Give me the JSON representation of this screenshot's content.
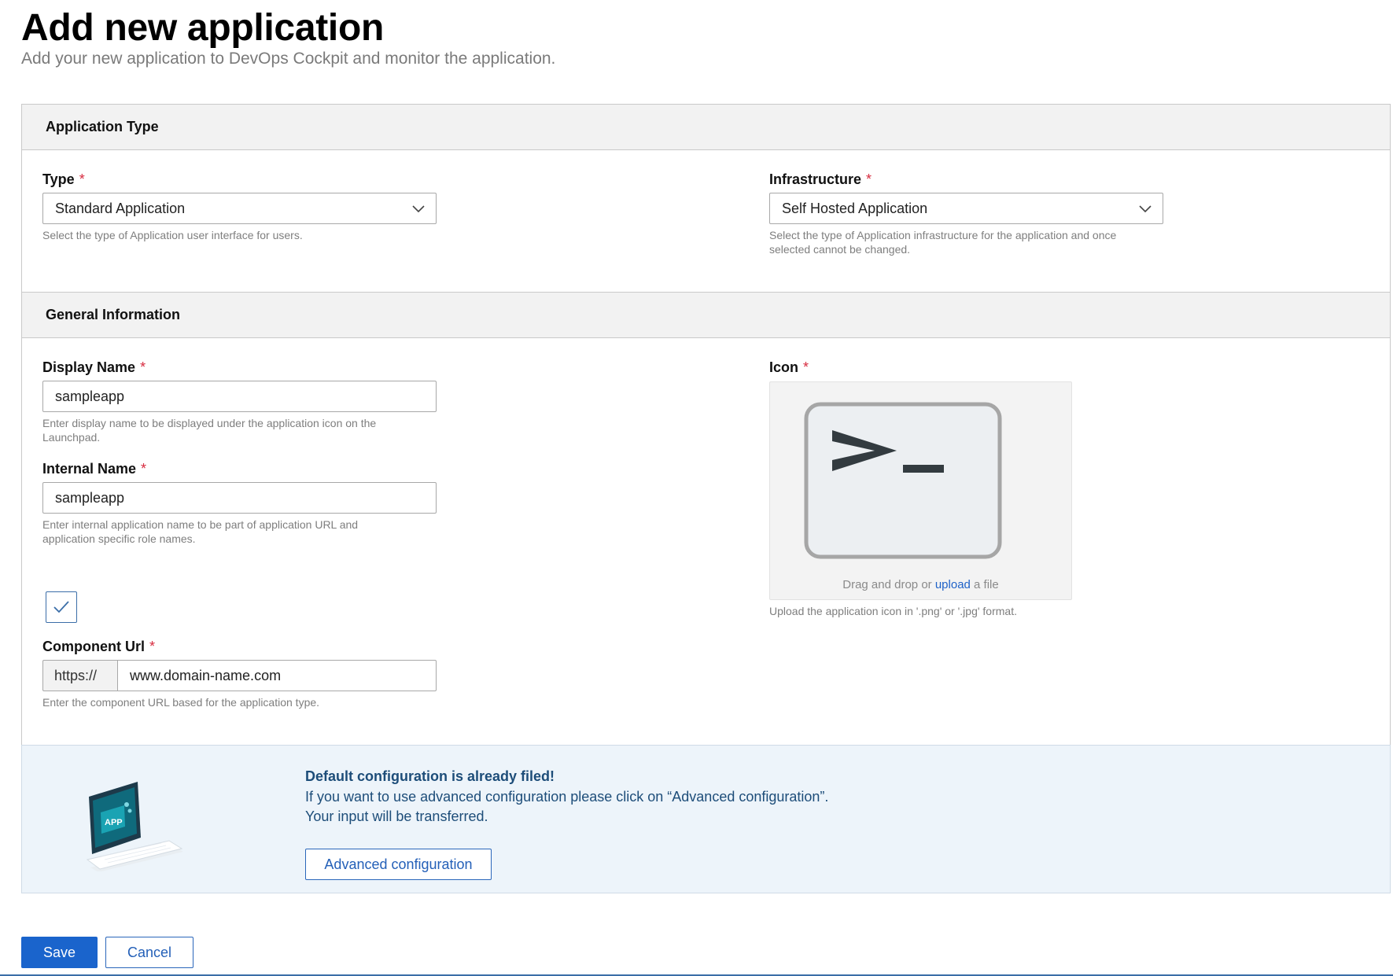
{
  "header": {
    "title": "Add new application",
    "subtitle": "Add your new application to DevOps Cockpit and monitor the application."
  },
  "application_type": {
    "section_title": "Application Type",
    "type": {
      "label": "Type",
      "required_mark": "*",
      "value": "Standard Application",
      "help": "Select the type of Application user interface for users."
    },
    "infrastructure": {
      "label": "Infrastructure",
      "required_mark": "*",
      "value": "Self Hosted Application",
      "help": "Select the type of Application infrastructure for the application and once selected cannot be changed."
    }
  },
  "general_information": {
    "section_title": "General Information",
    "display_name": {
      "label": "Display Name",
      "required_mark": "*",
      "value": "sampleapp",
      "help": "Enter display name to be displayed under the application icon on the Launchpad."
    },
    "internal_name": {
      "label": "Internal Name",
      "required_mark": "*",
      "value": "sampleapp",
      "help": "Enter internal application name to be part of application URL and application specific role names."
    },
    "checkbox": {
      "checked": true
    },
    "component_url": {
      "label": "Component Url",
      "required_mark": "*",
      "prefix": "https://",
      "value": "www.domain-name.com",
      "help": "Enter the component URL based for the application type."
    },
    "icon": {
      "label": "Icon",
      "required_mark": "*",
      "preview_icon": "terminal-prompt-icon",
      "drop_text_before": "Drag and drop or",
      "drop_link": "upload",
      "drop_text_after": "a file",
      "help": "Upload the application icon in '.png' or '.jpg' format."
    }
  },
  "banner": {
    "illustration": "laptop-app-illustration",
    "title": "Default configuration is already filed!",
    "line1": "If you want to use advanced configuration please click on “Advanced configuration”.",
    "line2": "Your input will be transferred.",
    "button_label": "Advanced configuration"
  },
  "actions": {
    "save_label": "Save",
    "cancel_label": "Cancel"
  },
  "colors": {
    "primary": "#1a64cc",
    "required": "#d72b3f",
    "banner_bg": "#edf4fa",
    "banner_text": "#1d4d79"
  }
}
